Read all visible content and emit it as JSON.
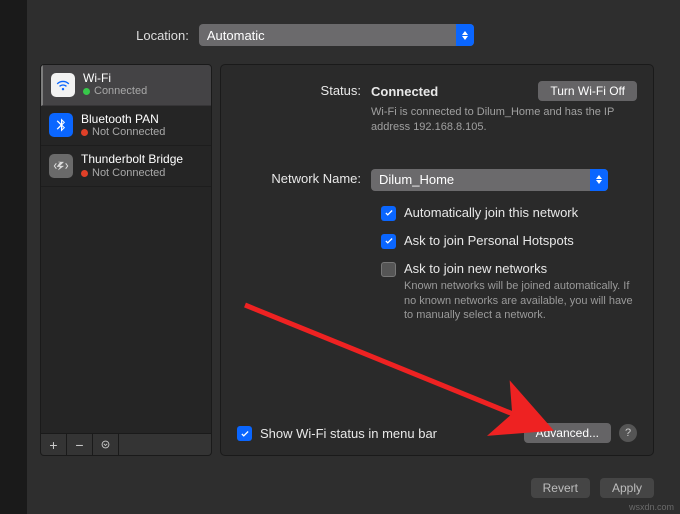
{
  "location": {
    "label": "Location:",
    "value": "Automatic"
  },
  "sidebar": {
    "items": [
      {
        "name": "Wi-Fi",
        "status": "Connected",
        "color": "green",
        "icon": "wifi"
      },
      {
        "name": "Bluetooth PAN",
        "status": "Not Connected",
        "color": "red",
        "icon": "bluetooth"
      },
      {
        "name": "Thunderbolt Bridge",
        "status": "Not Connected",
        "color": "red",
        "icon": "thunderbolt"
      }
    ]
  },
  "main": {
    "status_label": "Status:",
    "status_value": "Connected",
    "turn_off_label": "Turn Wi-Fi Off",
    "status_desc": "Wi-Fi is connected to Dilum_Home and has the IP address 192.168.8.105.",
    "network_label": "Network Name:",
    "network_value": "Dilum_Home",
    "auto_join_label": "Automatically join this network",
    "ask_hotspot_label": "Ask to join Personal Hotspots",
    "ask_new_label": "Ask to join new networks",
    "ask_new_desc": "Known networks will be joined automatically. If no known networks are available, you will have to manually select a network.",
    "show_status_label": "Show Wi-Fi status in menu bar",
    "advanced_label": "Advanced...",
    "help_label": "?"
  },
  "buttons": {
    "revert": "Revert",
    "apply": "Apply"
  },
  "watermark": "wsxdn.com"
}
